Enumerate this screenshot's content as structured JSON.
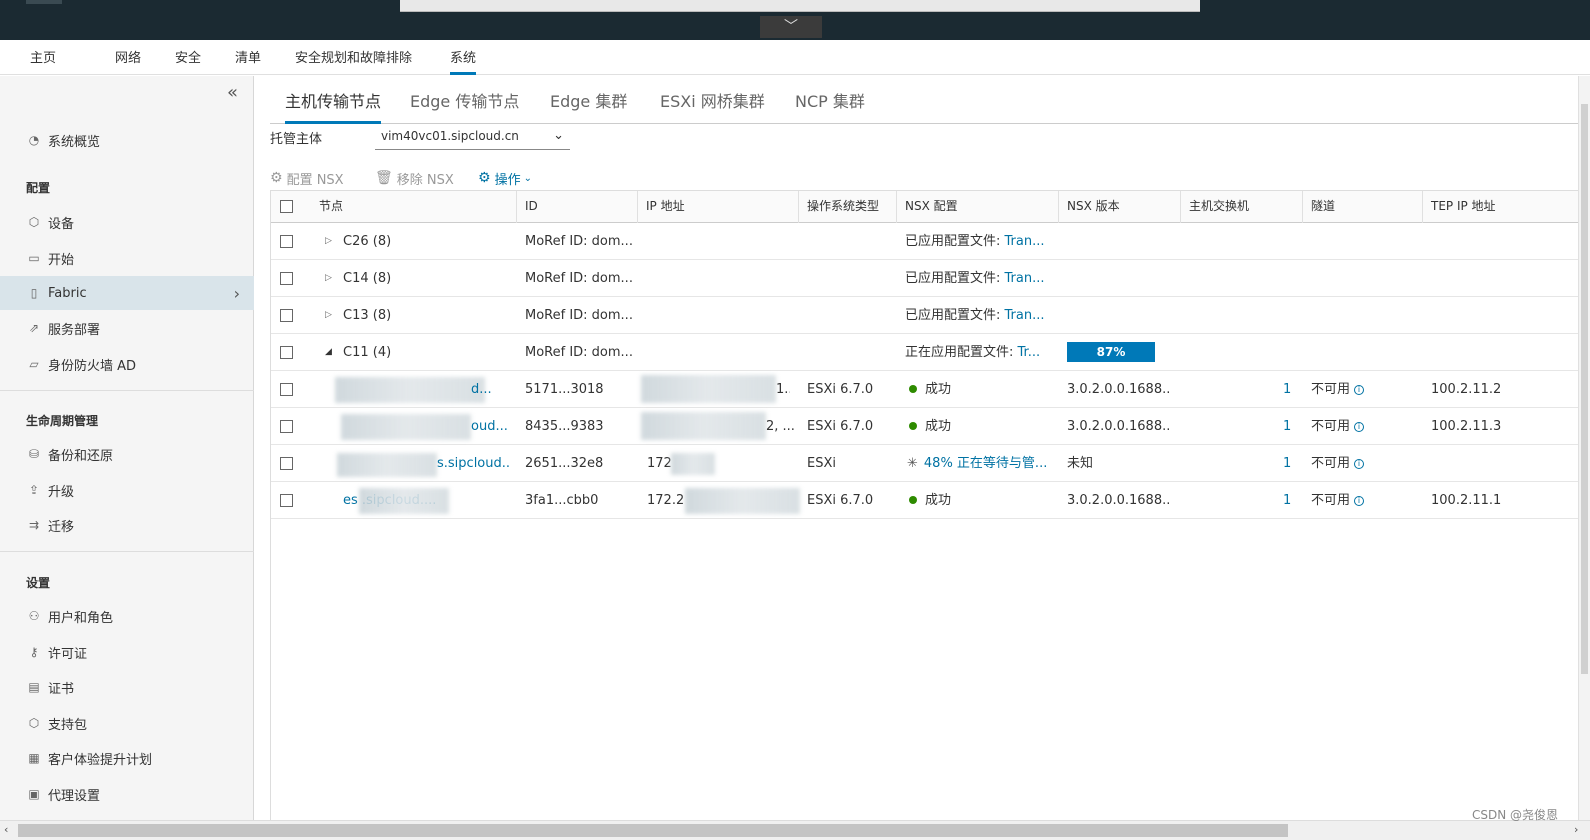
{
  "window": {
    "remote_toggle": "﹀"
  },
  "top_nav": {
    "tabs": [
      {
        "label": "主页"
      },
      {
        "label": "网络"
      },
      {
        "label": "安全"
      },
      {
        "label": "清单"
      },
      {
        "label": "安全规划和故障排除"
      },
      {
        "label": "系统"
      }
    ],
    "active": "系统"
  },
  "sidebar": {
    "collapse_glyph": "«",
    "overview": "系统概览",
    "section_config": "配置",
    "config_items": [
      {
        "label": "设备",
        "icon": "cube-icon"
      },
      {
        "label": "开始",
        "icon": "monitor-icon"
      },
      {
        "label": "Fabric",
        "icon": "server-icon"
      },
      {
        "label": "服务部署",
        "icon": "deploy-icon"
      },
      {
        "label": "身份防火墙 AD",
        "icon": "folder-icon"
      }
    ],
    "section_lifecycle": "生命周期管理",
    "lifecycle_items": [
      {
        "label": "备份和还原",
        "icon": "backup-icon"
      },
      {
        "label": "升级",
        "icon": "upgrade-icon"
      },
      {
        "label": "迁移",
        "icon": "migrate-icon"
      }
    ],
    "section_settings": "设置",
    "settings_items": [
      {
        "label": "用户和角色",
        "icon": "users-icon"
      },
      {
        "label": "许可证",
        "icon": "key-icon"
      },
      {
        "label": "证书",
        "icon": "certificate-icon"
      },
      {
        "label": "支持包",
        "icon": "package-icon"
      },
      {
        "label": "客户体验提升计划",
        "icon": "chart-icon"
      },
      {
        "label": "代理设置",
        "icon": "proxy-icon"
      }
    ]
  },
  "sub_tabs": [
    {
      "label": "主机传输节点"
    },
    {
      "label": "Edge 传输节点"
    },
    {
      "label": "Edge 集群"
    },
    {
      "label": "ESXi 网桥集群"
    },
    {
      "label": "NCP 集群"
    }
  ],
  "filter": {
    "label": "托管主体",
    "value": "vim40vc01.sipcloud.cn"
  },
  "toolbar": {
    "configure_nsx": "配置 NSX",
    "remove_nsx": "移除 NSX",
    "actions": "操作"
  },
  "table": {
    "columns": [
      "节点",
      "ID",
      "IP 地址",
      "操作系统类型",
      "NSX 配置",
      "NSX 版本",
      "主机交换机",
      "隧道",
      "TEP IP 地址"
    ],
    "clusters": [
      {
        "name": "C26 (8)",
        "id": "MoRef ID: dom...",
        "config_label": "已应用配置文件:",
        "config_link": "Tran..."
      },
      {
        "name": "C14 (8)",
        "id": "MoRef ID: dom...",
        "config_label": "已应用配置文件:",
        "config_link": "Tran..."
      },
      {
        "name": "C13 (8)",
        "id": "MoRef ID: dom...",
        "config_label": "已应用配置文件:",
        "config_link": "Tran..."
      },
      {
        "name": "C11 (4)",
        "id": "MoRef ID: dom...",
        "config_label": "正在应用配置文件:",
        "config_link": "Tr...",
        "progress": "87%"
      }
    ],
    "hosts": [
      {
        "node": "d...",
        "id": "5171...3018",
        "ip": "1...",
        "os": "ESXi 6.7.0",
        "status": "成功",
        "version": "3.0.2.0.0.1688...",
        "switches": "1",
        "tunnel": "不可用",
        "tep": "100.2.11.2"
      },
      {
        "node": "oud...",
        "id": "8435...9383",
        "ip": "2, ...",
        "os": "ESXi 6.7.0",
        "status": "成功",
        "version": "3.0.2.0.0.1688...",
        "switches": "1",
        "tunnel": "不可用",
        "tep": "100.2.11.3"
      },
      {
        "node": "s.sipcloud....",
        "id": "2651...32e8",
        "ip": "172",
        "os": "ESXi",
        "status": "48% 正在等待与管...",
        "version": "未知",
        "switches": "1",
        "tunnel": "不可用",
        "tep": ""
      },
      {
        "node": "es        .sipcloud....",
        "id": "3fa1...cbb0",
        "ip": "172.2",
        "os": "ESXi 6.7.0",
        "status": "成功",
        "version": "3.0.2.0.0.1688...",
        "switches": "1",
        "tunnel": "不可用",
        "tep": "100.2.11.1"
      }
    ]
  },
  "watermark": "CSDN @尧俊恩",
  "colors": {
    "accent": "#0079b8",
    "link": "#0072a3",
    "success": "#2e8b00",
    "topbar": "#1b2a32"
  }
}
